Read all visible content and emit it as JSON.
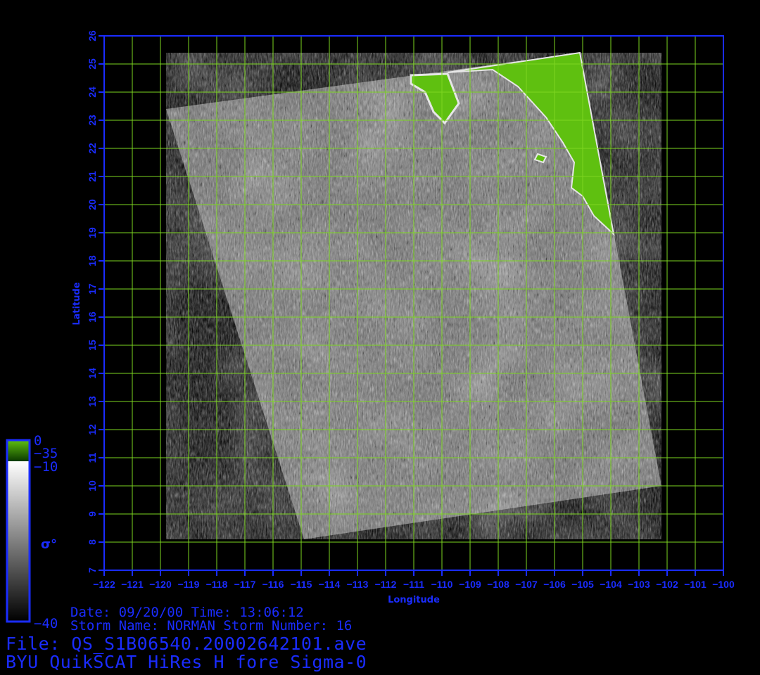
{
  "map": {
    "lon_range": [
      -122,
      -100
    ],
    "lat_range": [
      7,
      26
    ],
    "lon_ticks": [
      -122,
      -121,
      -120,
      -119,
      -118,
      -117,
      -116,
      -115,
      -114,
      -113,
      -112,
      -111,
      -110,
      -109,
      -108,
      -107,
      -106,
      -105,
      -104,
      -103,
      -102,
      -101,
      -100
    ],
    "lon_tick_labels": [
      "−122",
      "−121",
      "−120",
      "−119",
      "−118",
      "−117",
      "−116",
      "−115",
      "−114",
      "−113",
      "−112",
      "−111",
      "−110",
      "−109",
      "−108",
      "−107",
      "−106",
      "−105",
      "−104",
      "−103",
      "−102",
      "−101",
      "−100"
    ],
    "lat_ticks": [
      7,
      8,
      9,
      10,
      11,
      12,
      13,
      14,
      15,
      16,
      17,
      18,
      19,
      20,
      21,
      22,
      23,
      24,
      25,
      26
    ],
    "x_axis_label": "Longitude",
    "y_axis_label": "Latitude",
    "grid": true,
    "colors": {
      "frame": "#1a2cff",
      "grid": "#7cd620",
      "land": "#5fc010",
      "background": "#000000"
    },
    "swath_corners_lonlat": [
      [
        -119.8,
        23.4
      ],
      [
        -105.1,
        25.4
      ],
      [
        -102.2,
        10.0
      ],
      [
        -114.9,
        8.1
      ]
    ]
  },
  "colorbar": {
    "land_top_label": "0",
    "land_bottom_label": "−35",
    "top_label": "−10",
    "bottom_label": "−40",
    "quantity_label": "σ°"
  },
  "footer": {
    "line1": "Date: 09/20/00   Time: 13:06:12",
    "line2": "Storm Name: NORMAN   Storm Number: 16",
    "line3": "File: QS_S1B06540.20002642101.ave",
    "line4": "BYU QuikSCAT HiRes H fore Sigma-0"
  }
}
